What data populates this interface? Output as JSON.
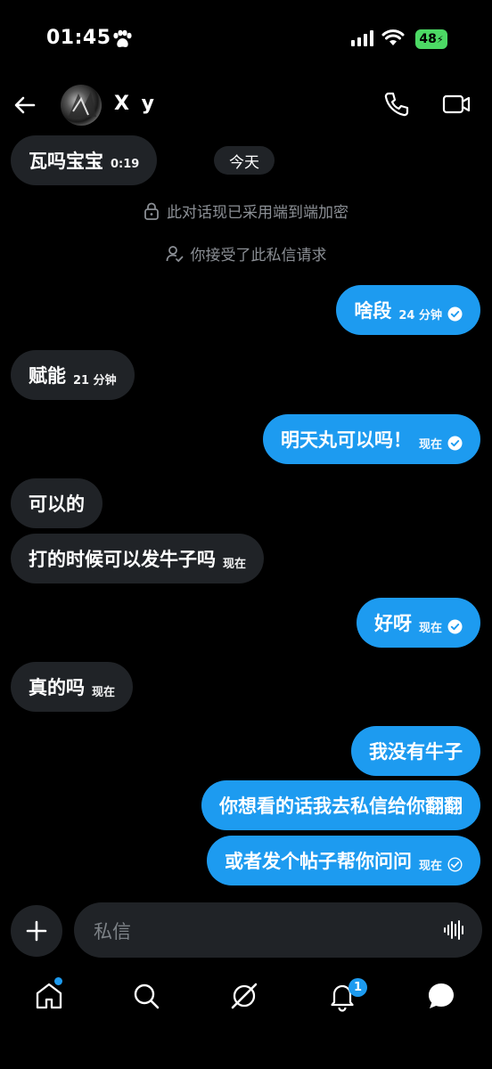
{
  "status_bar": {
    "time": "01:45",
    "battery": "48"
  },
  "header": {
    "contact_name": "X y"
  },
  "messages": [
    {
      "side": "in",
      "text": "瓦吗宝宝",
      "time": "0:19"
    },
    {
      "side": "out",
      "text": "啥段",
      "time": "24 分钟"
    },
    {
      "side": "in",
      "text": "赋能",
      "time": "21 分钟"
    },
    {
      "side": "out",
      "text": "明天丸可以吗！",
      "time": "现在"
    },
    {
      "side": "in",
      "text": "可以的",
      "time": ""
    },
    {
      "side": "in",
      "text": "打的时候可以发牛子吗",
      "time": "现在"
    },
    {
      "side": "out",
      "text": "好呀",
      "time": "现在"
    },
    {
      "side": "in",
      "text": "真的吗",
      "time": "现在"
    },
    {
      "side": "out",
      "text": "我没有牛子",
      "time": ""
    },
    {
      "side": "out",
      "text": "你想看的话我去私信给你翻翻",
      "time": ""
    },
    {
      "side": "out",
      "text": "或者发个帖子帮你问问",
      "time": "现在"
    }
  ],
  "date_chip": "今天",
  "system": {
    "encryption": "此对话现已采用端到端加密",
    "accepted": "你接受了此私信请求"
  },
  "composer": {
    "placeholder": "私信"
  },
  "tabbar": {
    "items": [
      "home-icon",
      "search-icon",
      "grok-icon",
      "notifications-icon",
      "messages-icon"
    ],
    "notifications_badge": "1"
  },
  "colors": {
    "accent": "#1d9bf0",
    "bubble_in": "#202327",
    "background": "#000000",
    "battery": "#4cd964"
  }
}
